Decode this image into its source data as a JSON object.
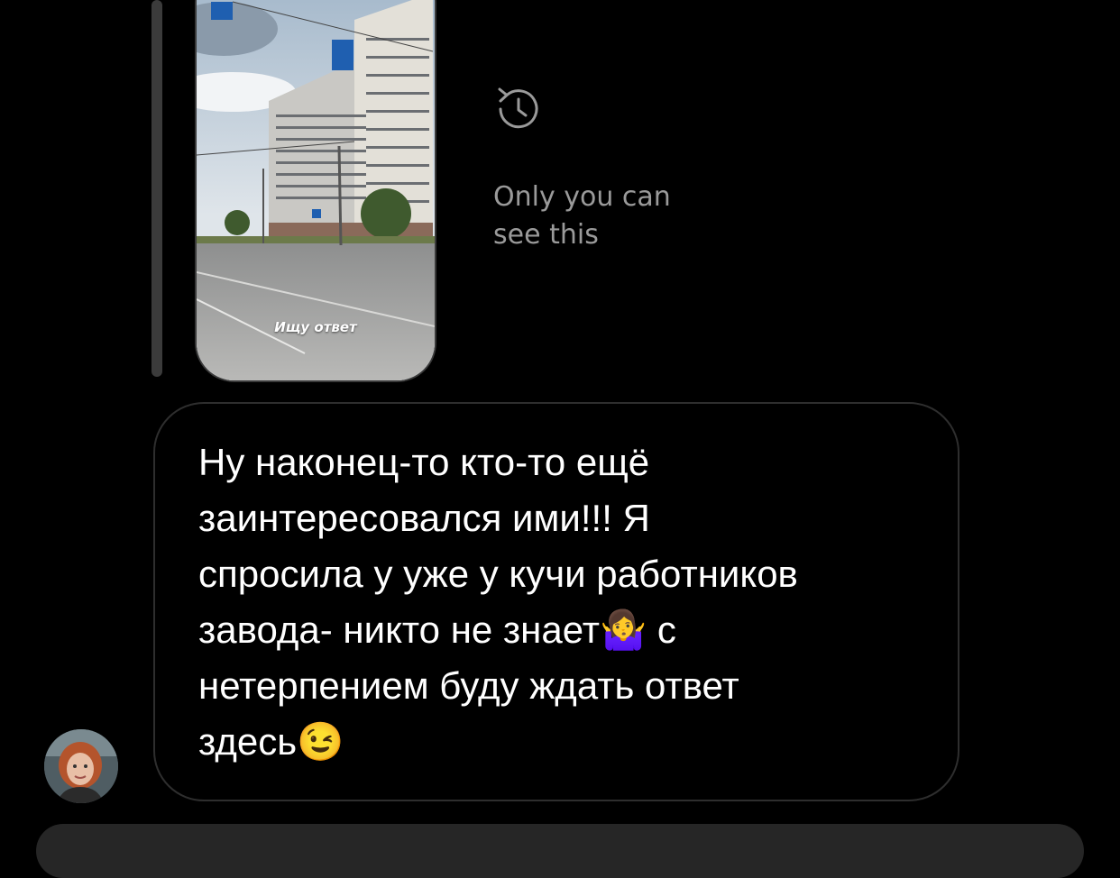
{
  "story": {
    "caption": "Ищу ответ"
  },
  "notice": {
    "text": "Only you can\nsee this",
    "icon": "history-icon"
  },
  "message": {
    "text": "Ну наконец-то кто-то ещё\nзаинтересовался ими!!! Я\nспросила у уже у кучи работников\nзавода- никто не знает🤷‍♀️ с\nнетерпением буду ждать ответ\nздесь😉"
  },
  "sender": {
    "avatar_icon": "user-avatar"
  },
  "colors": {
    "background": "#000000",
    "bubble_border": "#2e2e2e",
    "muted_text": "#9a9a9a",
    "input_bar": "#262626"
  }
}
